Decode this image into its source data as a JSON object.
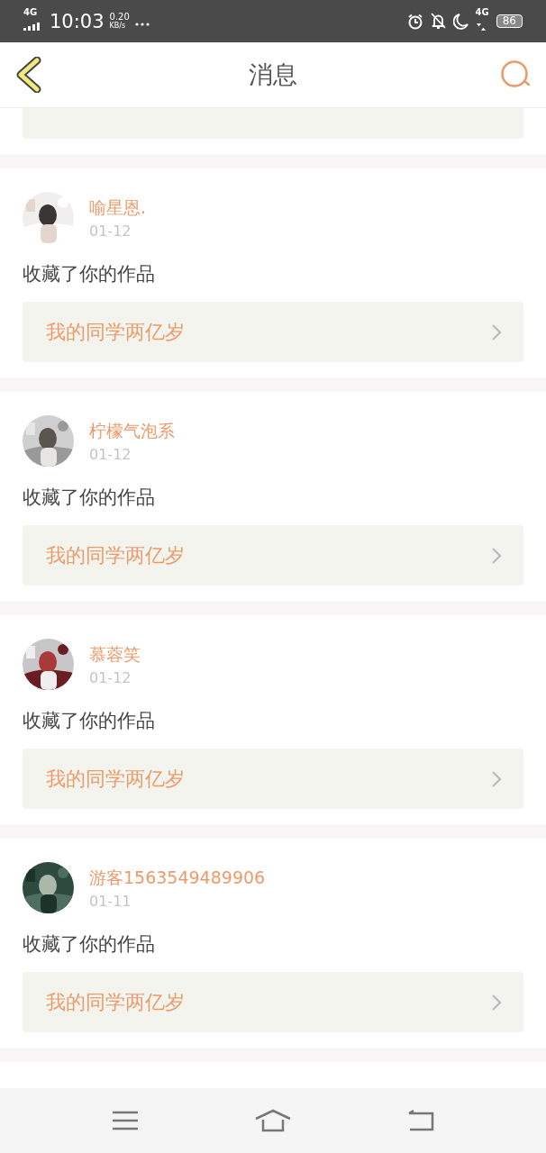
{
  "status_bar": {
    "network": "4G",
    "time": "10:03",
    "speed": "0.20",
    "speed_unit": "KB/s",
    "mobile_data": "4G",
    "battery": "86"
  },
  "header": {
    "title": "消息"
  },
  "messages": [
    {
      "name": "喻星恩.",
      "date": "01-12",
      "action": "收藏了你的作品",
      "link": "我的同学两亿岁"
    },
    {
      "name": "柠檬气泡系",
      "date": "01-12",
      "action": "收藏了你的作品",
      "link": "我的同学两亿岁"
    },
    {
      "name": "慕蓉笑",
      "date": "01-12",
      "action": "收藏了你的作品",
      "link": "我的同学两亿岁"
    },
    {
      "name": "游客1563549489906",
      "date": "01-11",
      "action": "收藏了你的作品",
      "link": "我的同学两亿岁"
    }
  ]
}
